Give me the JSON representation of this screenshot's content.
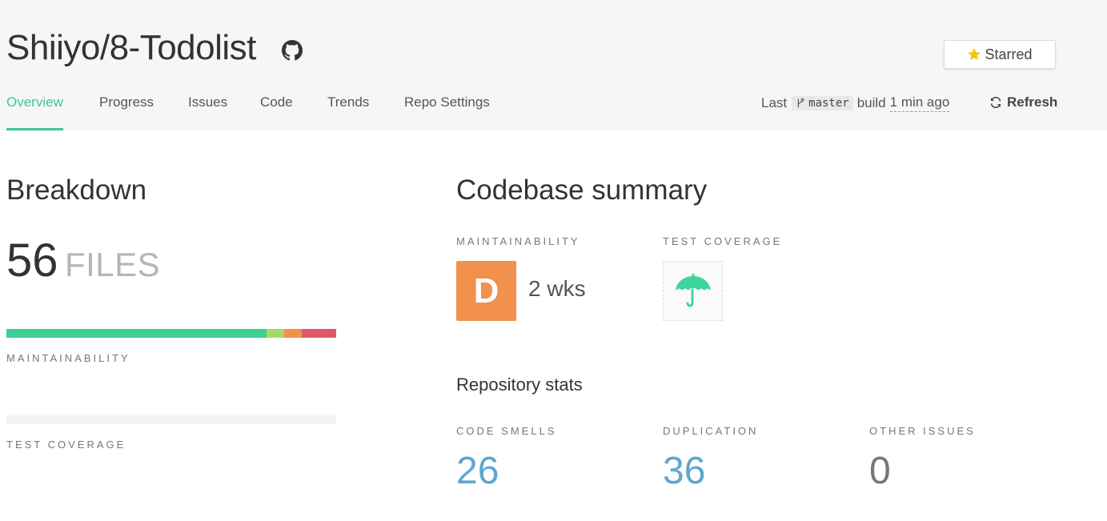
{
  "repo": {
    "title": "Shiiyo/8-Todolist",
    "github_icon": "github-icon",
    "star_label": "Starred",
    "star_icon": "star-icon"
  },
  "tabs": [
    {
      "label": "Overview",
      "active": true
    },
    {
      "label": "Progress",
      "active": false
    },
    {
      "label": "Issues",
      "active": false
    },
    {
      "label": "Code",
      "active": false
    },
    {
      "label": "Trends",
      "active": false
    },
    {
      "label": "Repo Settings",
      "active": false
    }
  ],
  "build": {
    "prefix": "Last",
    "branch_icon": "branch-icon",
    "branch": "master",
    "middle": "build",
    "time": "1 min ago",
    "refresh_label": "Refresh",
    "refresh_icon": "refresh-icon"
  },
  "breakdown": {
    "title": "Breakdown",
    "file_count": "56",
    "file_unit": "FILES",
    "maintainability_label": "MAINTAINABILITY",
    "maintainability_distribution": [
      {
        "grade": "A",
        "fraction": 0.79,
        "color": "#3cce94"
      },
      {
        "grade": "C",
        "fraction": 0.053,
        "color": "#a6d96a"
      },
      {
        "grade": "D",
        "fraction": 0.053,
        "color": "#f1914c"
      },
      {
        "grade": "F",
        "fraction": 0.104,
        "color": "#df5869"
      }
    ],
    "test_coverage_label": "TEST COVERAGE"
  },
  "summary": {
    "title": "Codebase summary",
    "maintainability_label": "MAINTAINABILITY",
    "grade": "D",
    "grade_color": "#f1914c",
    "debt": "2 wks",
    "test_coverage_label": "TEST COVERAGE",
    "coverage_icon": "umbrella-icon",
    "coverage_color": "#3fd59a"
  },
  "stats": {
    "title": "Repository stats",
    "code_smells_label": "CODE SMELLS",
    "code_smells": "26",
    "duplication_label": "DUPLICATION",
    "duplication": "36",
    "other_issues_label": "OTHER ISSUES",
    "other_issues": "0",
    "link_color": "#5ea6d0",
    "zero_color": "#777777"
  }
}
